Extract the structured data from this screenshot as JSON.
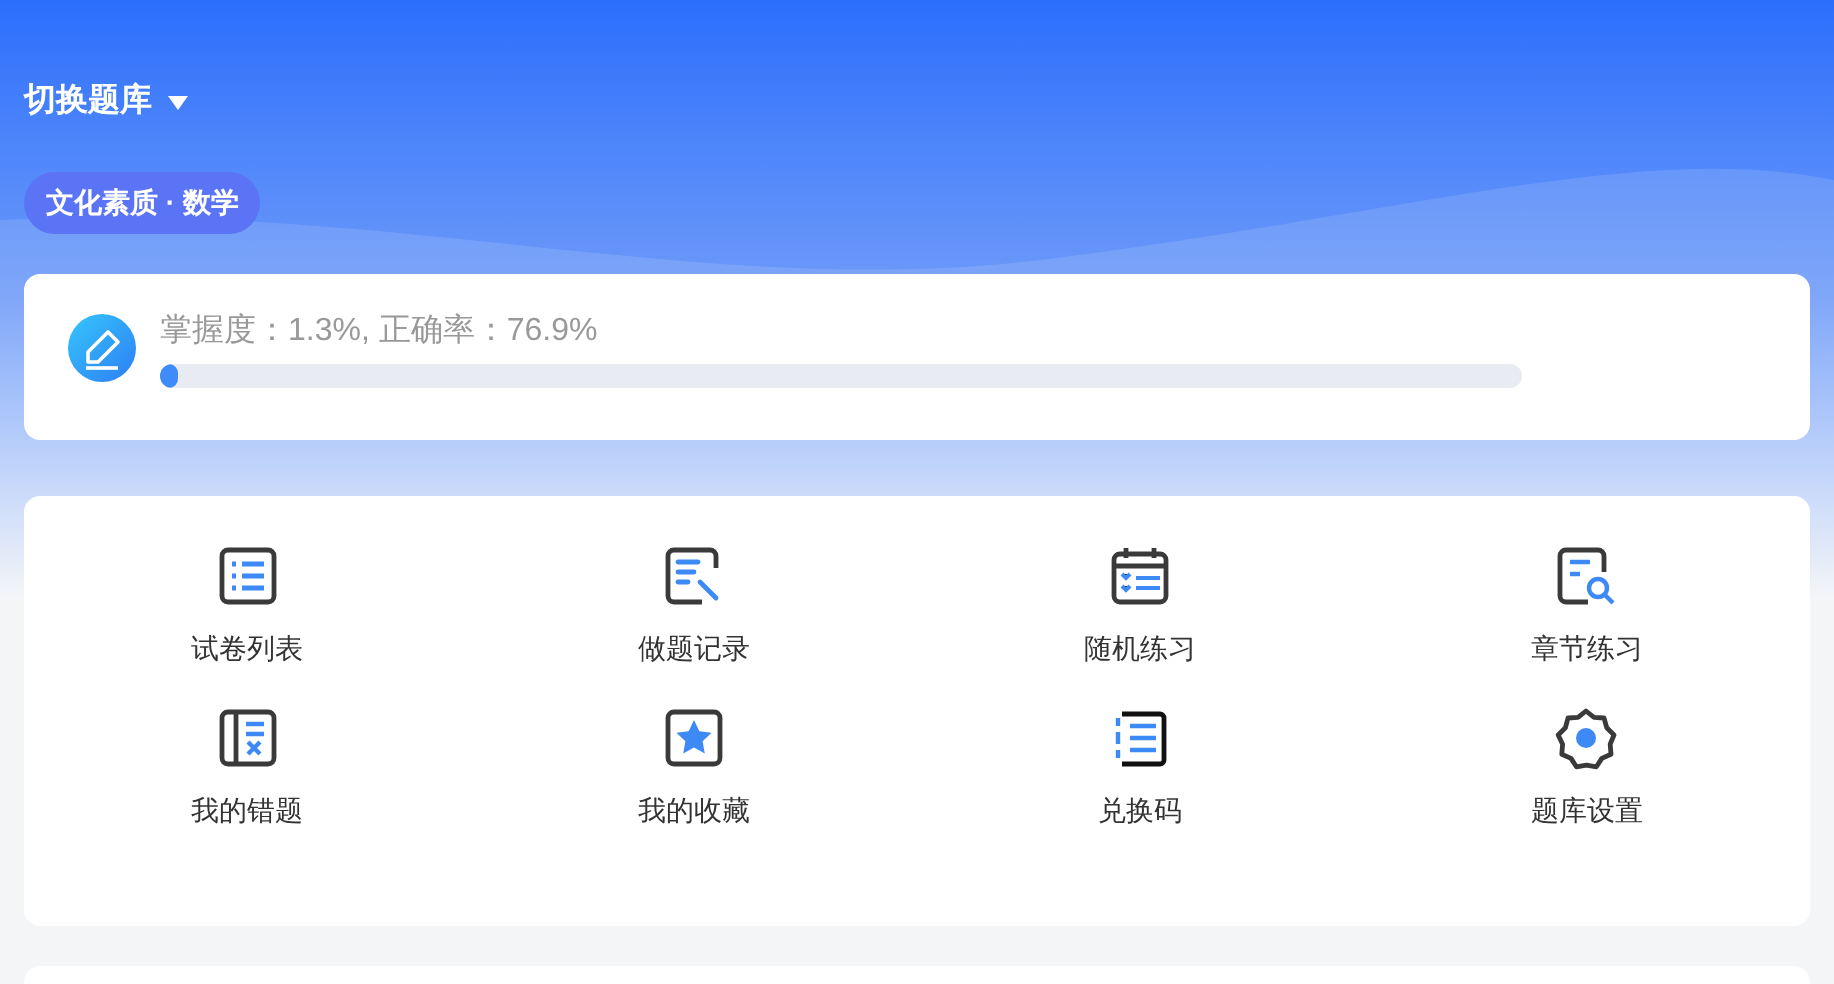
{
  "header": {
    "switch_label": "切换题库",
    "bank_tag": "文化素质 · 数学"
  },
  "progress": {
    "text": "掌握度：1.3%, 正确率：76.9%",
    "level": 0.013
  },
  "menu": [
    {
      "label": "试卷列表",
      "kind": "list"
    },
    {
      "label": "做题记录",
      "kind": "record"
    },
    {
      "label": "随机练习",
      "kind": "calendar"
    },
    {
      "label": "章节练习",
      "kind": "search"
    },
    {
      "label": "我的错题",
      "kind": "wrong"
    },
    {
      "label": "我的收藏",
      "kind": "star"
    },
    {
      "label": "兑换码",
      "kind": "code"
    },
    {
      "label": "题库设置",
      "kind": "gear"
    }
  ]
}
